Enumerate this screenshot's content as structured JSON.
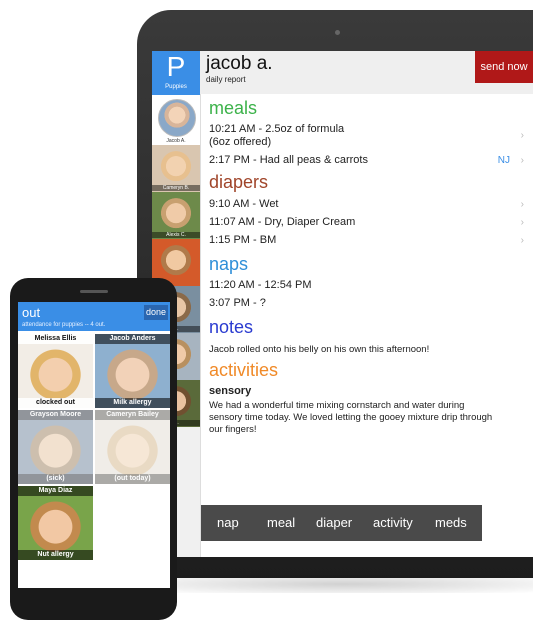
{
  "tablet": {
    "class_letter": "P",
    "class_name": "Puppies",
    "child_name": "jacob a.",
    "report_label": "daily report",
    "send_label": "send now",
    "selected_kid": "Jacob A.",
    "roster": [
      "Cameryn B.",
      "Alexis C.",
      "",
      "H.",
      "",
      "M."
    ],
    "sections": {
      "meals": "meals",
      "diapers": "diapers",
      "naps": "naps",
      "notes": "notes",
      "activities": "activities"
    },
    "meals": [
      {
        "text": "10:21 AM - 2.5oz of formula",
        "sub": "(6oz offered)"
      },
      {
        "text": "2:17 PM - Had all peas & carrots",
        "tag": "NJ"
      }
    ],
    "diapers": [
      "9:10 AM - Wet",
      "11:07 AM - Dry, Diaper Cream",
      "1:15 PM - BM"
    ],
    "naps": [
      "11:20 AM - 12:54 PM",
      "3:07 PM - ?"
    ],
    "note": "Jacob rolled onto his belly on his own this afternoon!",
    "activity_title": "sensory",
    "activity_text": "We had a wonderful time mixing cornstarch and water during sensory time today. We loved letting the gooey mixture drip through our fingers!",
    "tabs": [
      "nap",
      "meal",
      "diaper",
      "activity",
      "meds"
    ],
    "colors": {
      "meals": "#3cb24a",
      "diapers": "#a0452a",
      "naps": "#2f8fd8",
      "notes": "#2a3bd0",
      "activities": "#f08a28",
      "send": "#b01818"
    }
  },
  "phone": {
    "title": "out",
    "subtitle": "attendance for puppies -- 4 out.",
    "done_label": "done",
    "cards": [
      {
        "name": "Melissa Ellis",
        "status": "clocked out"
      },
      {
        "name": "Jacob Anders",
        "status": "Milk allergy"
      },
      {
        "name": "Grayson Moore",
        "status": "(sick)"
      },
      {
        "name": "Cameryn Bailey",
        "status": "(out today)"
      },
      {
        "name": "Maya Diaz",
        "status": "Nut allergy"
      }
    ]
  }
}
